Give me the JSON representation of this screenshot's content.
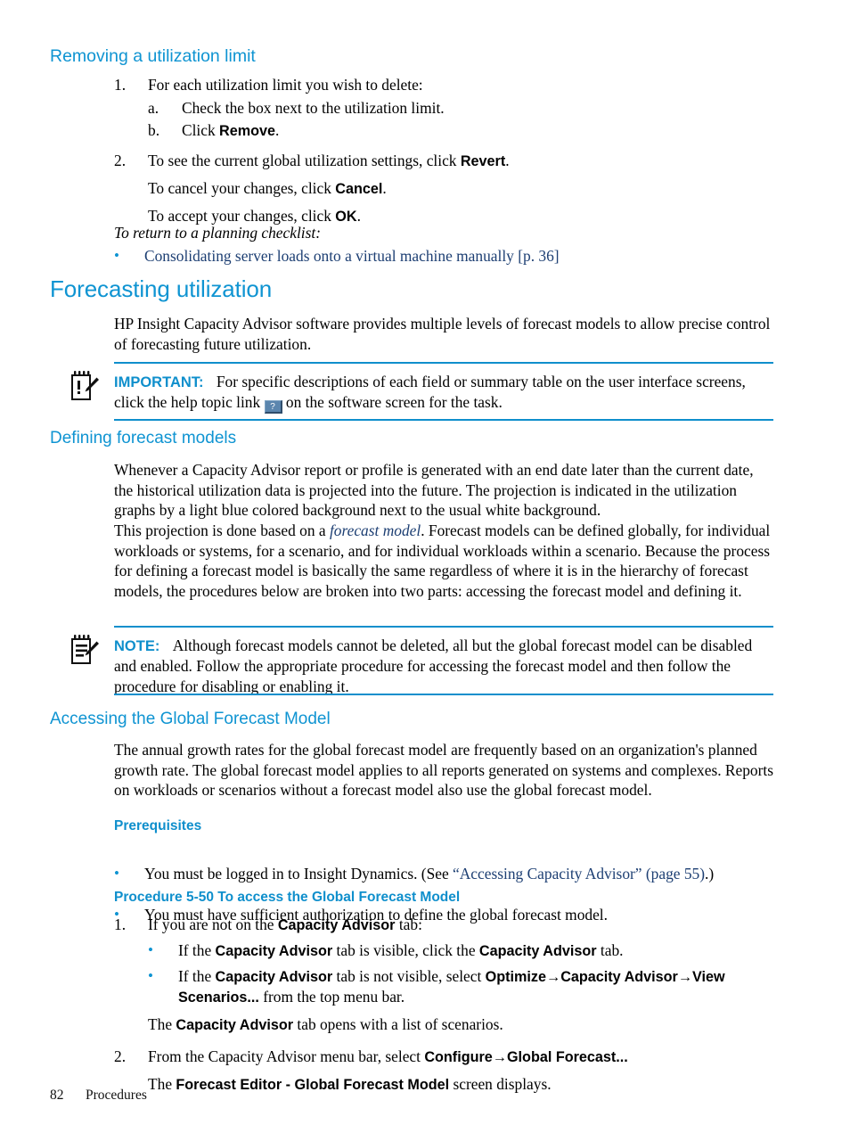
{
  "section_removing": {
    "heading": "Removing a utilization limit",
    "steps": [
      {
        "marker": "1.",
        "text": "For each utilization limit you wish to delete:",
        "substeps": [
          {
            "marker": "a.",
            "text": "Check the box next to the utilization limit."
          },
          {
            "marker": "b.",
            "pre": "Click ",
            "bold": "Remove",
            "post": "."
          }
        ]
      },
      {
        "marker": "2.",
        "pre": "To see the current global utilization settings, click ",
        "bold": "Revert",
        "post": ".",
        "followups": [
          {
            "pre": "To cancel your changes, click ",
            "bold": "Cancel",
            "post": "."
          },
          {
            "pre": "To accept your changes, click ",
            "bold": "OK",
            "post": "."
          }
        ]
      }
    ],
    "return_note": "To return to a planning checklist:",
    "return_link": "Consolidating server loads onto a virtual machine manually [p. 36]"
  },
  "section_forecasting": {
    "heading": "Forecasting utilization",
    "intro": "HP Insight Capacity Advisor software provides multiple levels of forecast models to allow precise control of forecasting future utilization.",
    "important": {
      "label": "IMPORTANT:",
      "icon": "note-pencil-important-icon",
      "text_before_chip": "For specific descriptions of each field or summary table on the user interface screens, click the help topic link",
      "chip_glyph": "?",
      "chip_name": "help-topic-link-icon",
      "text_after_chip": "on the software screen for the task."
    }
  },
  "section_defining": {
    "heading": "Defining forecast models",
    "para1": "Whenever a Capacity Advisor report or profile is generated with an end date later than the current date, the historical utilization data is projected into the future. The projection is indicated in the utilization graphs by a light blue colored background next to the usual white background.",
    "para2_pre": "This projection is done based on a ",
    "para2_link": "forecast model",
    "para2_post": ". Forecast models can be defined globally, for individual workloads or systems, for a scenario, and for individual workloads within a scenario. Because the process for defining a forecast model is basically the same regardless of where it is in the hierarchy of forecast models, the procedures below are broken into two parts: accessing the forecast model and defining it.",
    "note": {
      "label": "NOTE:",
      "icon": "note-pencil-icon",
      "text": "Although forecast models cannot be deleted, all but the global forecast model can be disabled and enabled. Follow the appropriate procedure for accessing the forecast model and then follow the procedure for disabling or enabling it."
    }
  },
  "section_accessing": {
    "heading": "Accessing the Global Forecast Model",
    "para1": "The annual growth rates for the global forecast model are frequently based on an organization's planned growth rate. The global forecast model applies to all reports generated on systems and complexes. Reports on workloads or scenarios without a forecast model also use the global forecast model.",
    "prereq_heading": "Prerequisites",
    "prereqs": [
      {
        "pre": "You must be logged in to Insight Dynamics. (See ",
        "link": "“Accessing Capacity Advisor” (page 55)",
        "post": ".)"
      },
      {
        "pre": "You must have sufficient authorization to define the global forecast model.",
        "link": "",
        "post": ""
      }
    ],
    "procedure_heading": "Procedure 5-50 To access the Global Forecast Model",
    "procedure_steps": [
      {
        "marker": "1.",
        "pre": "If you are not on the ",
        "bold": "Capacity Advisor",
        "post": " tab:",
        "bullets": [
          {
            "p1": "If the ",
            "b1": "Capacity Advisor",
            "p2": " tab is visible, click the ",
            "b2": "Capacity Advisor",
            "p3": " tab.",
            "b3": "",
            "p4": ""
          },
          {
            "p1": "If the ",
            "b1": "Capacity Advisor",
            "p2": " tab is not visible, select ",
            "b2": "Optimize→Capacity Advisor→View Scenarios...",
            "p3": " from the top menu bar.",
            "b3": "",
            "p4": ""
          }
        ],
        "trailing": {
          "pre": "The ",
          "bold": "Capacity Advisor",
          "post": " tab opens with a list of scenarios."
        }
      },
      {
        "marker": "2.",
        "pre": "From the Capacity Advisor menu bar, select ",
        "bold": "Configure→Global Forecast...",
        "post": "",
        "bullets": [],
        "trailing": {
          "pre": "The ",
          "bold": "Forecast Editor - Global Forecast Model",
          "post": " screen displays."
        }
      }
    ]
  },
  "footer": {
    "page_number": "82",
    "chapter": "Procedures"
  },
  "colors": {
    "heading_blue": "#0f94d2",
    "label_blue": "#0f8fcc",
    "xref_navy": "#1d3f73",
    "bullet_blue": "#0f94d2",
    "chip_blue": "#5b86ae"
  }
}
